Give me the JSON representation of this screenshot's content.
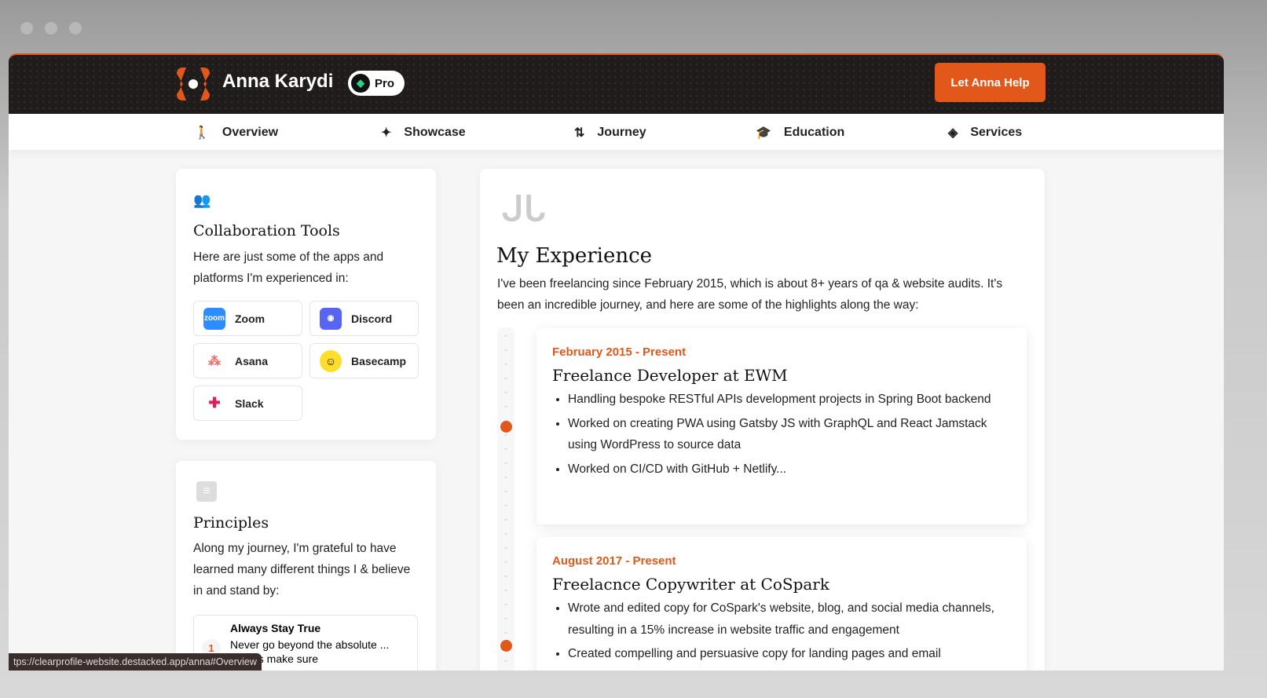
{
  "header": {
    "name": "Anna Karydi",
    "badge": "Pro",
    "cta": "Let Anna Help"
  },
  "nav": [
    {
      "label": "Overview",
      "icon": "person-icon"
    },
    {
      "label": "Showcase",
      "icon": "sparkle-icon"
    },
    {
      "label": "Journey",
      "icon": "route-icon"
    },
    {
      "label": "Education",
      "icon": "graduation-cap-icon"
    },
    {
      "label": "Services",
      "icon": "handshake-icon"
    }
  ],
  "tools": {
    "title": "Collaboration Tools",
    "desc": "Here are just some of the apps and platforms I'm experienced in:",
    "items": [
      {
        "label": "Zoom",
        "color": "#2d8cff"
      },
      {
        "label": "Discord",
        "color": "#5865f2"
      },
      {
        "label": "Asana",
        "color": "#f06a6a"
      },
      {
        "label": "Basecamp",
        "color": "#ffde2b"
      },
      {
        "label": "Slack",
        "color": "#4a154b"
      }
    ]
  },
  "principles": {
    "title": "Principles",
    "desc": "Along my journey, I'm grateful to have learned many different things I & believe in and stand by:",
    "items": [
      {
        "num": "1",
        "title": "Always Stay True",
        "text": "Never go beyond the absolute ... always make sure"
      }
    ]
  },
  "experience": {
    "title": "My Experience",
    "intro": "I've been freelancing since February 2015, which is about 8+ years of qa & website audits. It's been an incredible journey, and here are some of the highlights along the way:",
    "jobs": [
      {
        "date": "February 2015 - Present",
        "title": "Freelance Developer at EWM",
        "bullets": [
          "Handling bespoke RESTful APIs development projects in Spring Boot backend",
          "Worked on creating PWA using Gatsby JS with GraphQL and React Jamstack using WordPress to source data",
          "Worked on CI/CD with GitHub + Netlify..."
        ]
      },
      {
        "date": "August 2017 - Present",
        "title": "Freelacnce Copywriter at CoSpark",
        "bullets": [
          "Wrote and edited copy for CoSpark's website, blog, and social media channels, resulting in a 15% increase in website traffic and engagement",
          "Created compelling and persuasive copy for landing pages and email"
        ]
      }
    ]
  },
  "status_url": "tps://clearprofile-website.destacked.app/anna#Overview"
}
